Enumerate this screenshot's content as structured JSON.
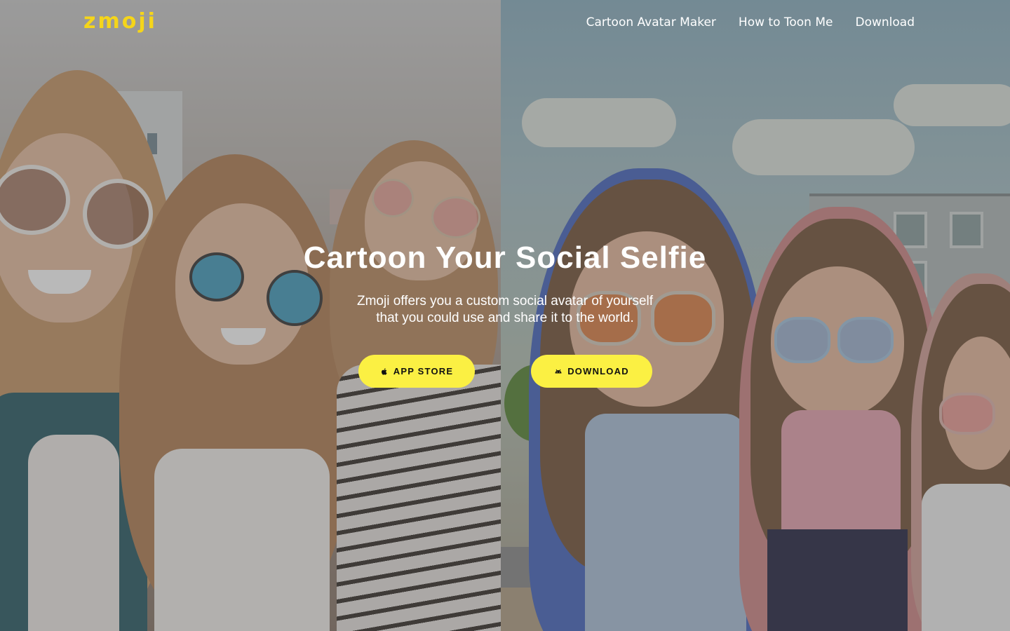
{
  "brand": {
    "logo_text": "zmoji",
    "logo_color": "#f5d51a"
  },
  "nav": {
    "links": [
      {
        "label": "Cartoon Avatar Maker"
      },
      {
        "label": "How to Toon Me"
      },
      {
        "label": "Download"
      }
    ]
  },
  "hero": {
    "title": "Cartoon Your Social Selfie",
    "subtitle_line1": "Zmoji offers you a custom social avatar of yourself",
    "subtitle_line2": "that you could use and share it to the world.",
    "buttons": {
      "app_store": {
        "label": "APP STORE",
        "icon": "apple-icon"
      },
      "download": {
        "label": "DOWNLOAD",
        "icon": "android-icon"
      }
    },
    "button_color": "#fbf043"
  }
}
